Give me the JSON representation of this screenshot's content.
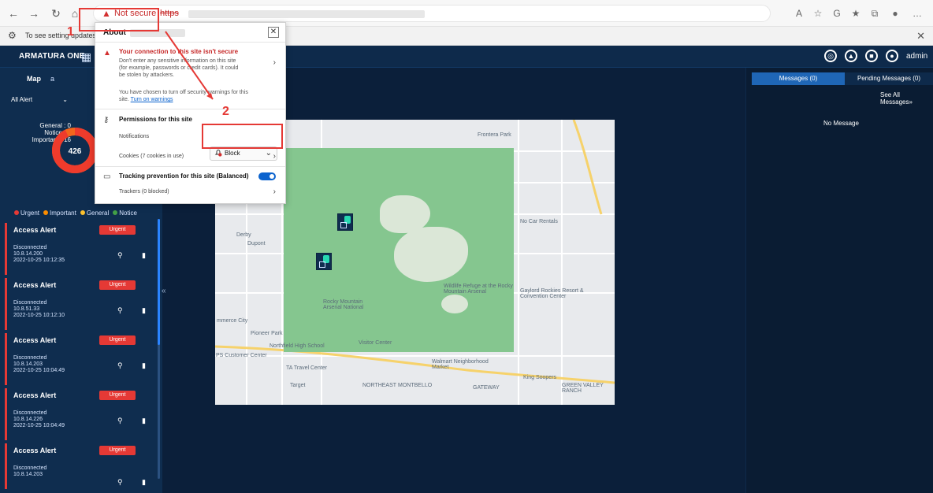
{
  "browser": {
    "not_secure": "Not secure",
    "https": "https",
    "infobar_text": "To see setting updates"
  },
  "app": {
    "brand": "ARMATURA ONE",
    "admin": "admin",
    "left": {
      "tab": "Map",
      "tab_suffix": "a",
      "filter": "All Alert",
      "donut": {
        "total": "426",
        "general": "General : 0",
        "notice": "Notice : 0",
        "important": "Important : 16"
      },
      "legend": [
        "Urgent",
        "Important",
        "General",
        "Notice"
      ],
      "alerts": [
        {
          "title": "Access Alert",
          "badge": "Urgent",
          "line1": "Disconnected",
          "line2": "10.8.14.200",
          "line3": "2022-10-25 10:12:35"
        },
        {
          "title": "Access Alert",
          "badge": "Urgent",
          "line1": "Disconnected",
          "line2": "10.8.51.33",
          "line3": "2022-10-25 10:12:10"
        },
        {
          "title": "Access Alert",
          "badge": "Urgent",
          "line1": "Disconnected",
          "line2": "10.8.14.203",
          "line3": "2022-10-25 10:04:49"
        },
        {
          "title": "Access Alert",
          "badge": "Urgent",
          "line1": "Disconnected",
          "line2": "10.8.14.226",
          "line3": "2022-10-25 10:04:49"
        },
        {
          "title": "Access Alert",
          "badge": "Urgent",
          "line1": "Disconnected",
          "line2": "10.8.14.203",
          "line3": ""
        }
      ]
    },
    "right": {
      "tab_active": "Messages (0)",
      "tab": "Pending Messages (0)",
      "see_all": "See All Messages»",
      "no_message": "No Message"
    }
  },
  "popup": {
    "about": "About",
    "conn_title": "Your connection to this site isn't secure",
    "conn_text_1": "Don't enter any sensitive information on this site",
    "conn_text_2": "(for example, passwords or credit cards). It could",
    "conn_text_3": "be stolen by attackers.",
    "warn_text_1": "You have chosen to turn off security warnings for this",
    "warn_text_2_prefix": "site.",
    "warn_link": "Turn on warnings",
    "permissions_title": "Permissions for this site",
    "notifications": "Notifications",
    "block": "Block",
    "cookies": "Cookies (7 cookies in use)",
    "tracking_title": "Tracking prevention for this site (Balanced)",
    "trackers": "Trackers (0 blocked)"
  },
  "annotations": {
    "num1": "1",
    "num2": "2"
  },
  "map_labels": {
    "derby": "Derby",
    "dupont": "Dupont",
    "commerce_city": "mmerce City",
    "pioneer_park": "Pioneer Park",
    "northfield": "Northfield High School",
    "customer_center": "PS Customer Center",
    "travel_center": "TA Travel Center",
    "target": "Target",
    "northeast": "NORTHEAST",
    "montbello": "MONTBELLO",
    "gateway": "GATEWAY",
    "green_valley": "GREEN VALLEY RANCH",
    "king_soopers": "King Soopers",
    "walmart": "Walmart Neighborhood Market",
    "gaylord": "Gaylord Rockies Resort & Convention Center",
    "wildlife": "Wildlife Refuge at the Rocky Mountain Arsenal",
    "nocar": "No Car Rentals",
    "frontera": "Frontera Park",
    "rocky": "Rocky Mountain Arsenal National",
    "visitor": "Visitor Center"
  },
  "colors": {
    "accent_red": "#e53935",
    "app_dark": "#0e2a4b",
    "park_green": "#85c68f",
    "tab_blue": "#1f66b6"
  }
}
